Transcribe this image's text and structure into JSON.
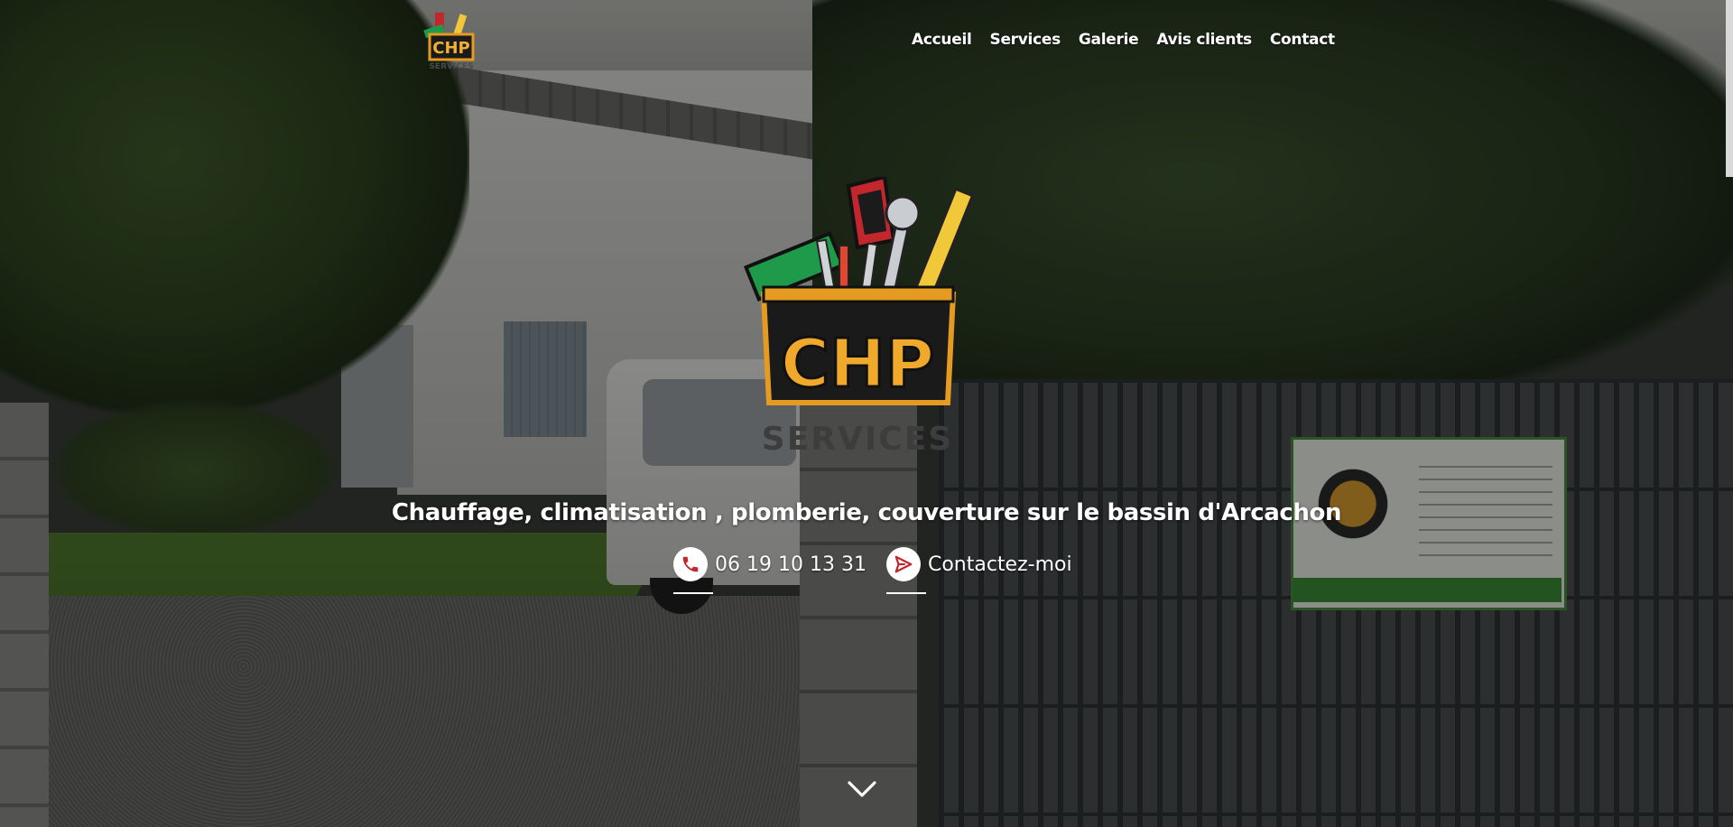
{
  "header": {
    "logo_alt": "CHP Services",
    "nav": [
      {
        "label": "Accueil"
      },
      {
        "label": "Services"
      },
      {
        "label": "Galerie"
      },
      {
        "label": "Avis clients"
      },
      {
        "label": "Contact"
      }
    ]
  },
  "hero": {
    "logo_text": "CHP",
    "logo_subtext": "SERVICES",
    "tagline": "Chauffage, climatisation , plomberie, couverture sur le bassin d'Arcachon",
    "phone": {
      "label": "06 19 10 13 31",
      "icon": "phone-icon"
    },
    "contact": {
      "label": "Contactez-moi",
      "icon": "send-icon"
    },
    "scroll_icon": "chevron-down-icon"
  },
  "sign": {
    "items": [
      "PLOMBERIE - CHAUFFAGE",
      "PEINTURE - CARRELAGE",
      "DIVERS TRAVAUX",
      "NEUF - RÉNOVATION"
    ],
    "name": "David Chapoullié",
    "phone": "06 19 10 13 31",
    "email": "davidchapoullie@gmail.com",
    "footer": "BASSIN D'ARCACHON  Siret : 800 778 052 00020"
  },
  "colors": {
    "accent_red": "#c1272d",
    "logo_orange": "#e59a22",
    "logo_green": "#1e9a4a",
    "text": "#ffffff"
  }
}
